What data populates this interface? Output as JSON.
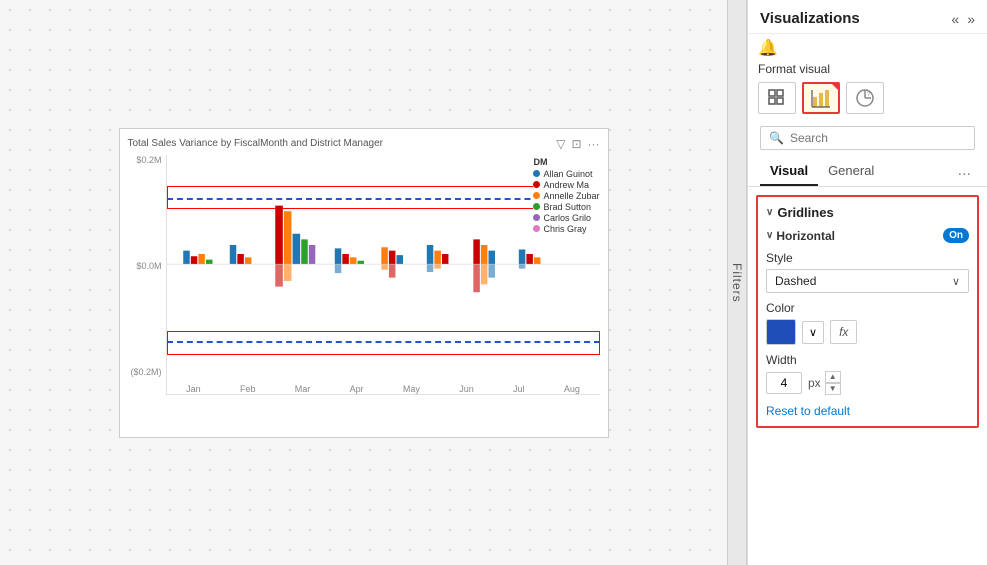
{
  "panel": {
    "title": "Visualizations",
    "format_label": "Format visual",
    "search_placeholder": "Search",
    "tabs": [
      "Visual",
      "General"
    ],
    "tab_more": "...",
    "active_tab": "Visual"
  },
  "chart": {
    "title": "Total Sales Variance by FiscalMonth and District Manager",
    "yaxis": [
      "$0.2M",
      "$0.0M",
      "($0.2M)"
    ],
    "xaxis": [
      "Jan",
      "Feb",
      "Mar",
      "Apr",
      "May",
      "Jun",
      "Jul",
      "Aug"
    ],
    "legend_title": "DM",
    "legend_items": [
      {
        "name": "Allan Guinot",
        "color": "#1f77b4"
      },
      {
        "name": "Andrew Ma",
        "color": "#cc0000"
      },
      {
        "name": "Annelle Zubar",
        "color": "#ff7f0e"
      },
      {
        "name": "Brad Sutton",
        "color": "#2ca02c"
      },
      {
        "name": "Carlos Grilo",
        "color": "#9467bd"
      },
      {
        "name": "Chris Gray",
        "color": "#e377c2"
      }
    ]
  },
  "gridlines": {
    "section_title": "Gridlines",
    "sub_title": "Horizontal",
    "toggle_label": "On",
    "style_label": "Style",
    "style_value": "Dashed",
    "color_label": "Color",
    "color_hex": "#1f4db7",
    "width_label": "Width",
    "width_value": "4",
    "width_unit": "px",
    "reset_label": "Reset to default"
  },
  "filters": {
    "label": "Filters"
  }
}
